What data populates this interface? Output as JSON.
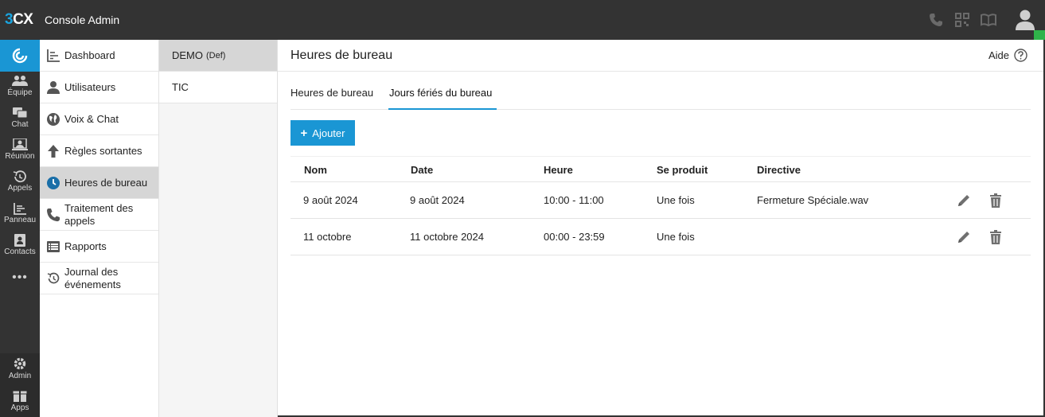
{
  "topbar": {
    "logo_3": "3",
    "logo_cx": "CX",
    "title": "Console Admin",
    "icons": [
      "phone-icon",
      "qr-code-icon",
      "book-icon",
      "user-avatar-icon"
    ],
    "status_color": "#2fb34a"
  },
  "rail": {
    "items": [
      {
        "label": "Équipe",
        "icon": "team-icon"
      },
      {
        "label": "Chat",
        "icon": "chat-icon"
      },
      {
        "label": "Réunion",
        "icon": "meeting-icon"
      },
      {
        "label": "Appels",
        "icon": "history-icon"
      },
      {
        "label": "Panneau",
        "icon": "panel-icon"
      },
      {
        "label": "Contacts",
        "icon": "contacts-icon"
      }
    ],
    "more": "•••",
    "bottom": [
      {
        "label": "Admin",
        "icon": "gear-icon"
      },
      {
        "label": "Apps",
        "icon": "apps-icon"
      }
    ]
  },
  "nav": {
    "items": [
      {
        "label": "Dashboard",
        "icon": "dashboard-icon"
      },
      {
        "label": "Utilisateurs",
        "icon": "user-icon"
      },
      {
        "label": "Voix & Chat",
        "icon": "globe-icon"
      },
      {
        "label": "Règles sortantes",
        "icon": "arrow-up-icon"
      },
      {
        "label": "Heures de bureau",
        "icon": "clock-icon",
        "active": true
      },
      {
        "label": "Traitement des appels",
        "icon": "phone-icon"
      },
      {
        "label": "Rapports",
        "icon": "list-icon"
      },
      {
        "label": "Journal des événements",
        "icon": "history-icon"
      }
    ]
  },
  "groups": {
    "items": [
      {
        "label": "DEMO",
        "suffix": "(Def)",
        "active": true
      },
      {
        "label": "TIC",
        "suffix": ""
      }
    ]
  },
  "main": {
    "title": "Heures de bureau",
    "help_label": "Aide",
    "tabs": [
      {
        "label": "Heures de bureau",
        "active": false
      },
      {
        "label": "Jours fériés du bureau",
        "active": true
      }
    ],
    "add_label": "Ajouter",
    "accent": "#1a96d4",
    "table": {
      "headers": [
        "Nom",
        "Date",
        "Heure",
        "Se produit",
        "Directive"
      ],
      "rows": [
        {
          "nom": "9 août 2024",
          "date": "9 août 2024",
          "heure": "10:00 - 11:00",
          "se_produit": "Une fois",
          "directive": "Fermeture Spéciale.wav"
        },
        {
          "nom": "11 octobre",
          "date": "11 octobre 2024",
          "heure": "00:00 - 23:59",
          "se_produit": "Une fois",
          "directive": ""
        }
      ]
    }
  }
}
